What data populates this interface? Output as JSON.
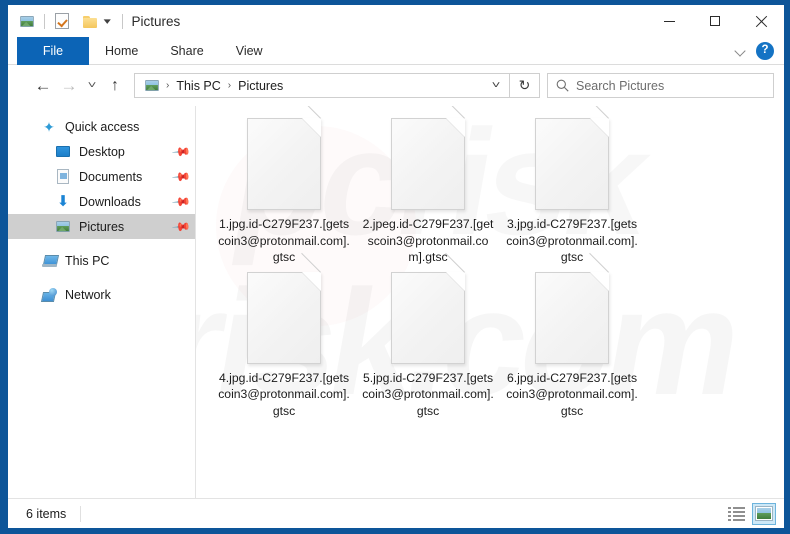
{
  "window": {
    "title": "Pictures",
    "quick_access_icons": [
      "picture-icon",
      "properties-checkmark-icon",
      "new-folder-icon",
      "customize-dropdown-caret"
    ],
    "controls": {
      "minimize": "minimize-button",
      "maximize": "maximize-button",
      "close": "close-button"
    }
  },
  "ribbon": {
    "tabs": [
      {
        "label": "File",
        "selected": true
      },
      {
        "label": "Home",
        "selected": false
      },
      {
        "label": "Share",
        "selected": false
      },
      {
        "label": "View",
        "selected": false
      }
    ],
    "expand_label": "∨",
    "help_label": "?"
  },
  "nav": {
    "back": "←",
    "forward": "→",
    "recent": "˅",
    "up": "↑",
    "breadcrumbs": [
      "This PC",
      "Pictures"
    ],
    "breadcrumb_separator": "›",
    "address_dropdown": "˅",
    "refresh": "↻"
  },
  "search": {
    "placeholder": "Search Pictures",
    "icon": "search-icon",
    "value": ""
  },
  "sidebar": {
    "items": [
      {
        "label": "Quick access",
        "icon": "star-icon",
        "level": 0,
        "pinned": false,
        "selected": false
      },
      {
        "label": "Desktop",
        "icon": "desktop-icon",
        "level": 1,
        "pinned": true,
        "selected": false
      },
      {
        "label": "Documents",
        "icon": "documents-icon",
        "level": 1,
        "pinned": true,
        "selected": false
      },
      {
        "label": "Downloads",
        "icon": "downloads-icon",
        "level": 1,
        "pinned": true,
        "selected": false
      },
      {
        "label": "Pictures",
        "icon": "pictures-icon",
        "level": 1,
        "pinned": true,
        "selected": true
      },
      {
        "label": "This PC",
        "icon": "this-pc-icon",
        "level": 0,
        "pinned": false,
        "selected": false
      },
      {
        "label": "Network",
        "icon": "network-icon",
        "level": 0,
        "pinned": false,
        "selected": false
      }
    ],
    "pin_glyph": "✒"
  },
  "content": {
    "watermark_text": "pcrisk",
    "watermark_text2": "risk.com",
    "files": [
      {
        "name": "1.jpg.id-C279F237.[getscoin3@protonmail.com].gtsc",
        "icon": "generic-file-icon"
      },
      {
        "name": "2.jpeg.id-C279F237.[getscoin3@protonmail.com].gtsc",
        "icon": "generic-file-icon"
      },
      {
        "name": "3.jpg.id-C279F237.[getscoin3@protonmail.com].gtsc",
        "icon": "generic-file-icon"
      },
      {
        "name": "4.jpg.id-C279F237.[getscoin3@protonmail.com].gtsc",
        "icon": "generic-file-icon"
      },
      {
        "name": "5.jpg.id-C279F237.[getscoin3@protonmail.com].gtsc",
        "icon": "generic-file-icon"
      },
      {
        "name": "6.jpg.id-C279F237.[getscoin3@protonmail.com].gtsc",
        "icon": "generic-file-icon"
      }
    ]
  },
  "status": {
    "item_count_text": "6 items",
    "views": [
      {
        "name": "details-view-button",
        "active": false
      },
      {
        "name": "large-icons-view-button",
        "active": true
      }
    ]
  }
}
